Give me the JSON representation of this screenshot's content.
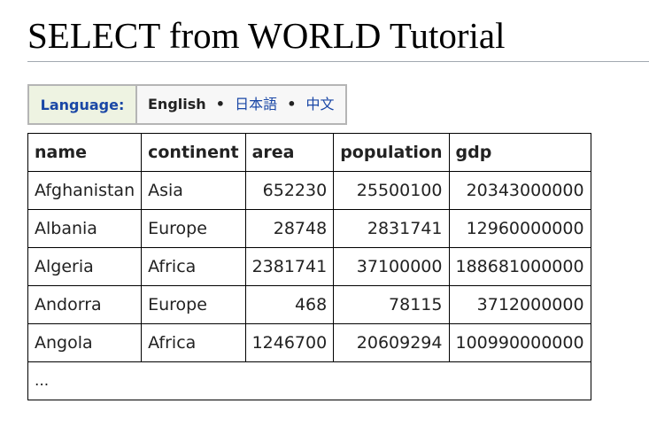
{
  "title": "SELECT from WORLD Tutorial",
  "language": {
    "label": "Language:",
    "current": "English",
    "links": [
      "日本語",
      "中文"
    ],
    "separator": "•"
  },
  "table": {
    "headers": [
      "name",
      "continent",
      "area",
      "population",
      "gdp"
    ],
    "rows": [
      [
        "Afghanistan",
        "Asia",
        "652230",
        "25500100",
        "20343000000"
      ],
      [
        "Albania",
        "Europe",
        "28748",
        "2831741",
        "12960000000"
      ],
      [
        "Algeria",
        "Africa",
        "2381741",
        "37100000",
        "188681000000"
      ],
      [
        "Andorra",
        "Europe",
        "468",
        "78115",
        "3712000000"
      ],
      [
        "Angola",
        "Africa",
        "1246700",
        "20609294",
        "100990000000"
      ]
    ],
    "more": "..."
  }
}
